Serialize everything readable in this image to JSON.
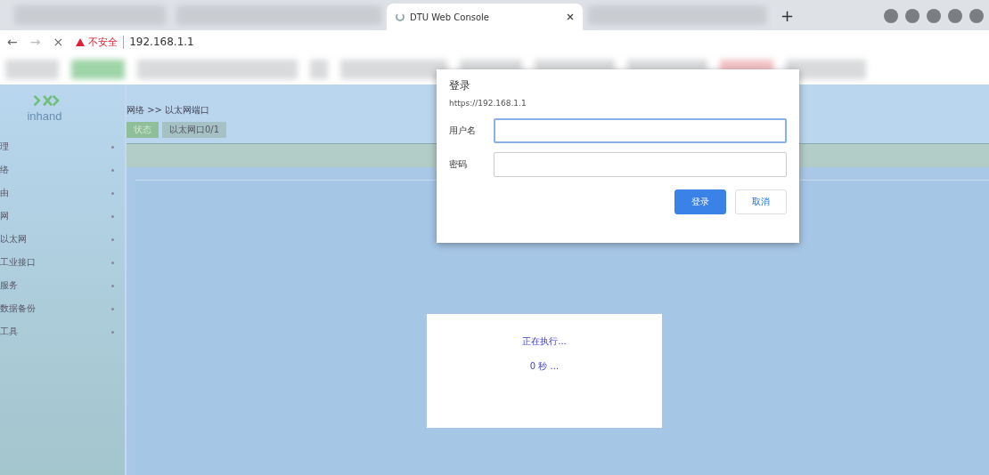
{
  "browser": {
    "active_tab": {
      "title": "DTU Web Console",
      "loading": true
    },
    "new_tab": "+",
    "nav": {
      "back": "←",
      "forward": "→",
      "stop": "×"
    },
    "security": {
      "warning": "不安全",
      "url": "192.168.1.1"
    }
  },
  "app": {
    "logo": "inhand",
    "breadcrumb": "网络 >> 以太网端口",
    "subtabs": [
      {
        "label": "状态",
        "selected": true
      },
      {
        "label": "以太网口0/1",
        "selected": false
      }
    ],
    "menu": [
      {
        "label": "理"
      },
      {
        "label": "络"
      },
      {
        "label": "由"
      },
      {
        "label": "网"
      },
      {
        "label": "以太网"
      },
      {
        "label": "工业接口"
      },
      {
        "label": "服务"
      },
      {
        "label": "数据备份"
      },
      {
        "label": "工具"
      }
    ],
    "progress": {
      "status": "正在执行...",
      "elapsed": "0 秒 ..."
    }
  },
  "dialog": {
    "title": "登录",
    "origin": "https://192.168.1.1",
    "fields": [
      {
        "label": "用户名",
        "focused": true
      },
      {
        "label": "密码",
        "focused": false
      }
    ],
    "buttons": [
      {
        "label": "登录",
        "kind": "primary"
      },
      {
        "label": "取消",
        "kind": "secondary"
      }
    ]
  }
}
